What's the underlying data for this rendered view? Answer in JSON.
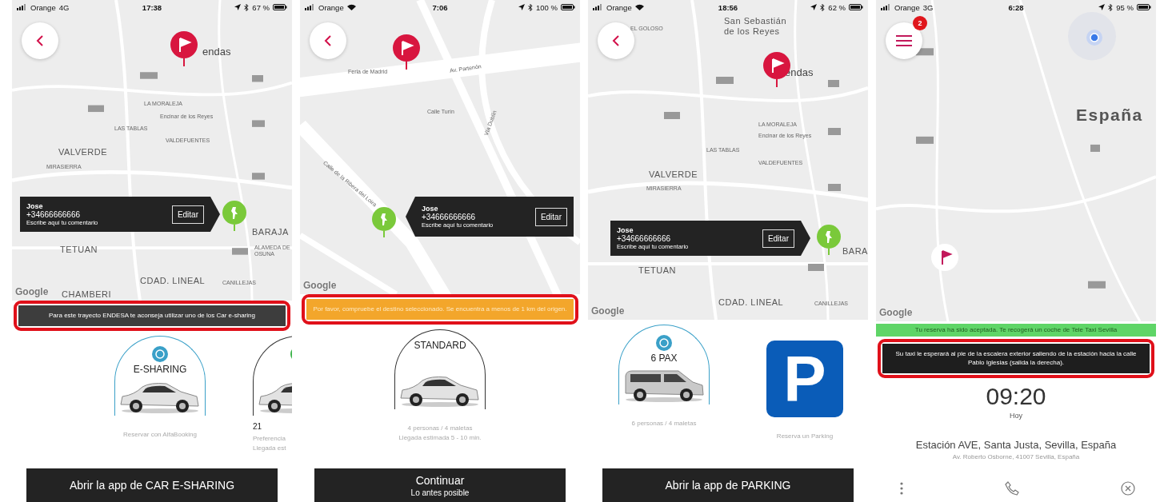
{
  "phones": [
    {
      "status": {
        "carrier": "Orange",
        "network": "4G",
        "time": "17:38",
        "battery": "67 %"
      },
      "nav": {
        "kind": "back"
      },
      "map": {
        "labels": [
          "endas",
          "LA MORALEJA",
          "Encinar de los Reyes",
          "LAS TABLAS",
          "VALDEFUENTES",
          "VALVERDE",
          "MIRASIERRA",
          "TETUAN",
          "BARAJA",
          "ALAMEDA DE OSUNA",
          "CDAD. LINEAL",
          "CANILLEJAS",
          "CHAMBERI"
        ],
        "logo": "Google"
      },
      "callout": {
        "name": "Jose",
        "phone": "+34666666666",
        "comment": "Escribe aquí tu comentario",
        "button": "Editar"
      },
      "banners": [
        {
          "kind": "dark",
          "text": "Para este trayecto ENDESA te aconseja utilizar uno de los Car e-sharing",
          "highlighted": true
        }
      ],
      "options": [
        {
          "kind": "car",
          "title": "E-SHARING",
          "color": "#3aa0c8",
          "captions": [
            "Reservar con AlfaBooking"
          ]
        },
        {
          "kind": "car",
          "color": "#333333",
          "price": "21",
          "captions": [
            "Preferencia",
            "Llegada est"
          ]
        }
      ],
      "action": {
        "label": "Abrir la app de CAR E-SHARING"
      }
    },
    {
      "status": {
        "carrier": "Orange",
        "wifi": true,
        "time": "7:06",
        "battery": "100 %"
      },
      "nav": {
        "kind": "back"
      },
      "map": {
        "labels": [
          "Feria de Madrid",
          "Av. Partenón",
          "Calle Turín",
          "Vía Dublín",
          "Calle de la Ribera del Loira"
        ],
        "logo": "Google"
      },
      "callout": {
        "name": "Jose",
        "phone": "+34666666666",
        "comment": "Escribe aquí tu comentario",
        "button": "Editar"
      },
      "banners": [
        {
          "kind": "orange",
          "text": "Por favor, compruebe el destino seleccionado. Se encuentra a menos de 1 km del origen.",
          "highlighted": true
        }
      ],
      "options": [
        {
          "kind": "car",
          "title": "STANDARD",
          "color": "#333333",
          "captions": [
            "4 personas / 4 maletas",
            "Llegada estimada 5 - 10 min."
          ]
        }
      ],
      "action": {
        "label": "Continuar",
        "sublabel": "Lo antes posible"
      }
    },
    {
      "status": {
        "carrier": "Orange",
        "wifi": true,
        "time": "18:56",
        "battery": "62 %"
      },
      "nav": {
        "kind": "back"
      },
      "map": {
        "labels": [
          "EL GOLOSO",
          "San Sebastián de los Reyes",
          "endas",
          "LA MORALEJA",
          "Encinar de los Reyes",
          "LAS TABLAS",
          "VALDEFUENTES",
          "VALVERDE",
          "MIRASIERRA",
          "TETUAN",
          "BARA",
          "CDAD. LINEAL",
          "CANILLEJAS"
        ],
        "logo": "Google"
      },
      "callout": {
        "name": "Jose",
        "phone": "+34666666666",
        "comment": "Escribe aquí tu comentario",
        "button": "Editar"
      },
      "options": [
        {
          "kind": "van",
          "title": "6 PAX",
          "color": "#3aa0c8",
          "captions": [
            "6 personas / 4 maletas"
          ]
        },
        {
          "kind": "parking",
          "title": "P",
          "captions": [
            "Reserva un Parking"
          ]
        }
      ],
      "action": {
        "label": "Abrir la app de PARKING"
      }
    },
    {
      "status": {
        "carrier": "Orange",
        "network": "3G",
        "time": "6:28",
        "battery": "95 %"
      },
      "nav": {
        "kind": "menu",
        "badge": "2"
      },
      "map": {
        "labels": [
          "España"
        ],
        "logo": "Google"
      },
      "banners": [
        {
          "kind": "green",
          "text": "Tu reserva ha sido aceptada. Te recogerá un coche de Tele Taxi Sevilla",
          "highlighted": false
        },
        {
          "kind": "black",
          "text": "Su taxi le esperará al pie de la escalera exterior saliendo de la estación hacia la calle Pablo Iglesias (salida la derecha).",
          "highlighted": true
        }
      ],
      "booking": {
        "time": "09:20",
        "day": "Hoy",
        "address": "Estación AVE, Santa Justa, Sevilla, España",
        "subaddress": "Av. Roberto Osborne, 41007 Sevilla, España"
      }
    }
  ]
}
